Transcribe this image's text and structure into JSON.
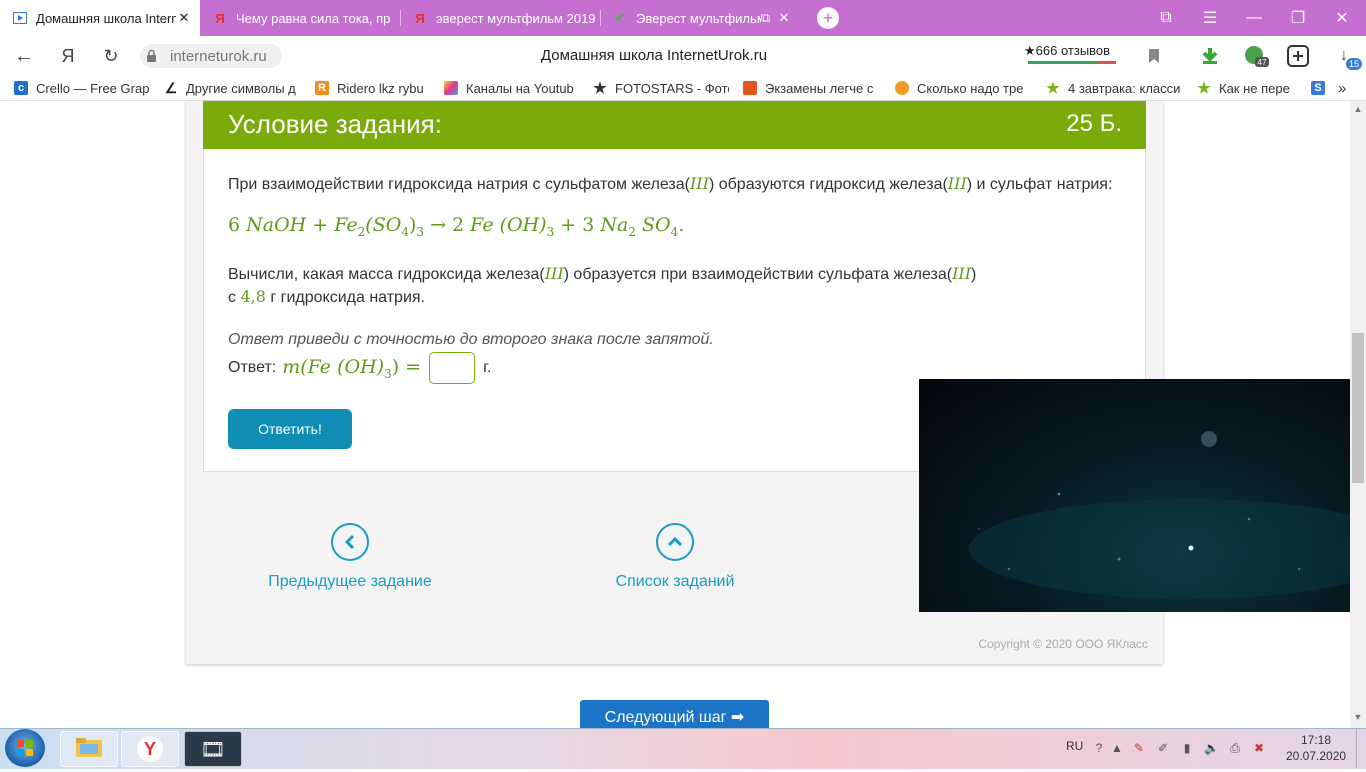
{
  "browser": {
    "tabs": [
      {
        "title": "Домашняя школа InternetUrok.ru",
        "icon": "video-play-icon",
        "active": true
      },
      {
        "title": "Чему равна сила тока, пр",
        "icon": "yandex-icon",
        "active": false
      },
      {
        "title": "эверест мультфильм 2019",
        "icon": "yandex-icon",
        "active": false
      },
      {
        "title": "Эверест мультфильм",
        "icon": "checkmark-icon",
        "active": false
      }
    ],
    "address": "interneturok.ru",
    "page_title": "Домашняя школа InternetUrok.ru",
    "reviews": "★666 отзывов",
    "downloads_badge": "15",
    "badge_47": "47",
    "bookmarks": [
      {
        "label": "Crello — Free Grap",
        "icon_color": "#1f6fd1"
      },
      {
        "label": "Другие символы д",
        "icon_color": "#222"
      },
      {
        "label": "Ridero lkz rybu",
        "icon_color": "#f08b1d"
      },
      {
        "label": "Каналы на Youtub",
        "icon_color": "#d63d8f"
      },
      {
        "label": "FOTOSTARS - Фото",
        "icon_color": "#333"
      },
      {
        "label": "Экзамены легче с",
        "icon_color": "#e2571e"
      },
      {
        "label": "Сколько надо тре",
        "icon_color": "#f39a23"
      },
      {
        "label": "4 завтрака: класси",
        "icon_color": "#7bb31a"
      },
      {
        "label": "Как не пере",
        "icon_color": "#7bb31a"
      }
    ]
  },
  "task": {
    "header_title": "Условие задания:",
    "points": "25 Б.",
    "p1_a": "При взаимодействии гидроксида натрия с сульфатом железа(",
    "p1_roman1": "III",
    "p1_b": ") образуются гидроксид железа(",
    "p1_roman2": "III",
    "p1_c": ") и сульфат натрия:",
    "equation": {
      "c1": "6",
      "naoh": "NaOH",
      "plus1": "+",
      "fe": "Fe",
      "sub2": "2",
      "so4": "(SO",
      "sub4": "4",
      "sub3": "3",
      "arrow": "→",
      "c2": "2",
      "feoh": "Fe (OH)",
      "sub3b": "3",
      "plus2": "+",
      "c3": "3",
      "na": "Na",
      "sub2b": "2",
      "so4b": "SO",
      "sub4b": "4",
      "dot": "."
    },
    "p2_a": "Вычисли, какая масса гидроксида железа(",
    "p2_roman1": "III",
    "p2_b": ") образуется при взаимодействии сульфата железа(",
    "p2_roman2": "III",
    "p2_c": ")",
    "p2_d": "с",
    "p2_num": "4,8",
    "p2_e": "г гидроксида натрия.",
    "hint": "Ответ приведи с точностью до второго знака после запятой.",
    "answer_label": "Ответ:",
    "answer_expr_pre": "m(Fe (OH)",
    "answer_expr_sub": "3",
    "answer_expr_post": ") =",
    "answer_value": "",
    "answer_unit": "г.",
    "submit_label": "Ответить!"
  },
  "nav": {
    "prev_label": "Предыдущее задание",
    "list_label": "Список заданий",
    "copyright": "Copyright © 2020 ООО ЯКласс",
    "next_step_label": "Следующий шаг ➡"
  },
  "taskbar": {
    "lang": "RU",
    "time": "17:18",
    "date": "20.07.2020"
  }
}
